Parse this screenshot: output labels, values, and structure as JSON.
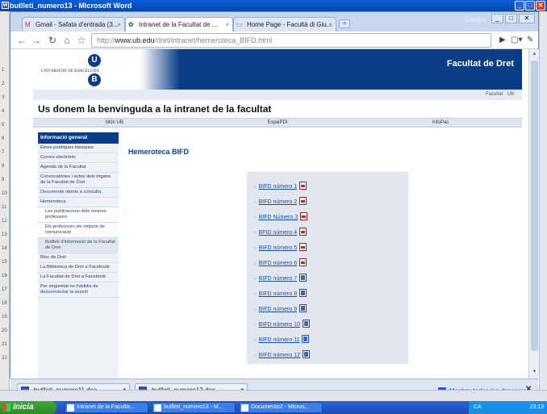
{
  "word_window": {
    "title": "butlleti_numero13 - Microsoft Word",
    "ruler_ticks": [
      "1",
      "2",
      "3",
      "4",
      "5",
      "6",
      "7",
      "8",
      "9",
      "10",
      "11",
      "12",
      "13",
      "14",
      "15",
      "16",
      "17",
      "18",
      "19",
      "20",
      "21",
      "22"
    ]
  },
  "chrome": {
    "tabs": [
      {
        "label": "Gmail - Safata d'entrada (3...",
        "icon": "gmail-icon"
      },
      {
        "label": "Intranet de la Facultat de ...",
        "icon": "ub-favicon"
      },
      {
        "label": "Home Page - Facultà di Giu...",
        "icon": "page-icon"
      }
    ],
    "user_label": "Google",
    "url_prefix": "http://",
    "url_host": "www.ub.edu",
    "url_path": "/dret/intranet/hemeroteca_BIFD.html"
  },
  "site": {
    "university": "UNIVERSITAT DE BARCELONA",
    "logo_letters": [
      "U",
      "B"
    ],
    "faculty": "Facultat de Dret",
    "breadcrumb": "Facultat · UB",
    "welcome": "Us donem la benvinguda a la intranet de la facultat",
    "topnav": [
      "Món UB",
      "EspaiPDI",
      "InfoPas"
    ],
    "sidebar_head": "Informació general",
    "sidebar": [
      {
        "label": "Eines jurídiques bàsiques",
        "sub": false,
        "hl": false
      },
      {
        "label": "Correu electrònic",
        "sub": false,
        "hl": false
      },
      {
        "label": "Agenda de la Facultat",
        "sub": false,
        "hl": false
      },
      {
        "label": "Convocatòries i actes dels òrgans de la Facultat de Dret",
        "sub": false,
        "hl": false
      },
      {
        "label": "Documents oberts a consulta",
        "sub": false,
        "hl": false
      },
      {
        "label": "Hemeroteca",
        "sub": false,
        "hl": false
      },
      {
        "label": "Les publicacions dels nostres professors",
        "sub": true,
        "hl": false
      },
      {
        "label": "Els professors als mitjans de comunicació",
        "sub": true,
        "hl": false
      },
      {
        "label": "Butlletí d'informació de la Facultat de Dret",
        "sub": true,
        "hl": true
      },
      {
        "label": "Bloc de Dret",
        "sub": false,
        "hl": false
      },
      {
        "label": "La Biblioteca de Dret a Facebook",
        "sub": false,
        "hl": false
      },
      {
        "label": "La Facultat de Dret a Facebook",
        "sub": false,
        "hl": false
      },
      {
        "label": "Per seguretat no t'oblidis de desconnectar la sessió",
        "sub": false,
        "hl": false
      }
    ],
    "content_title": "Hemeroteca BIFD",
    "documents": [
      {
        "label": "BIFD número 1",
        "type": "pdf-icon"
      },
      {
        "label": "BIFD número 2",
        "type": "pdf-icon"
      },
      {
        "label": "BIFD Número 3",
        "type": "pdf-icon"
      },
      {
        "label": "BFID número 4",
        "type": "pdf-icon"
      },
      {
        "label": "BIFD número 5",
        "type": "pdf-icon"
      },
      {
        "label": "BIFD número 6",
        "type": "pdf-icon"
      },
      {
        "label": "BIFD número 7",
        "type": "word-doc-icon"
      },
      {
        "label": "BIFD número 8",
        "type": "word-doc-icon"
      },
      {
        "label": "BIFD número 9",
        "type": "word-doc-icon"
      },
      {
        "label": "BIFD número 10",
        "type": "word-doc-icon"
      },
      {
        "label": "BIFD número 11",
        "type": "word-doc-icon"
      },
      {
        "label": "BIFD número 12",
        "type": "word-doc-icon"
      }
    ]
  },
  "downloads": {
    "items": [
      "butlleti_numero11.doc",
      "butlleti_numero12.doc"
    ],
    "show_all": "Mostrar todas las descargas...",
    "close": "✕"
  },
  "taskbar": {
    "start": "Inicia",
    "tasks": [
      "Intranet de la Faculta...",
      "butlleti_numero13 - M...",
      "Documento2 - Micros..."
    ],
    "tray_lang": "CA",
    "clock": "23:13"
  }
}
